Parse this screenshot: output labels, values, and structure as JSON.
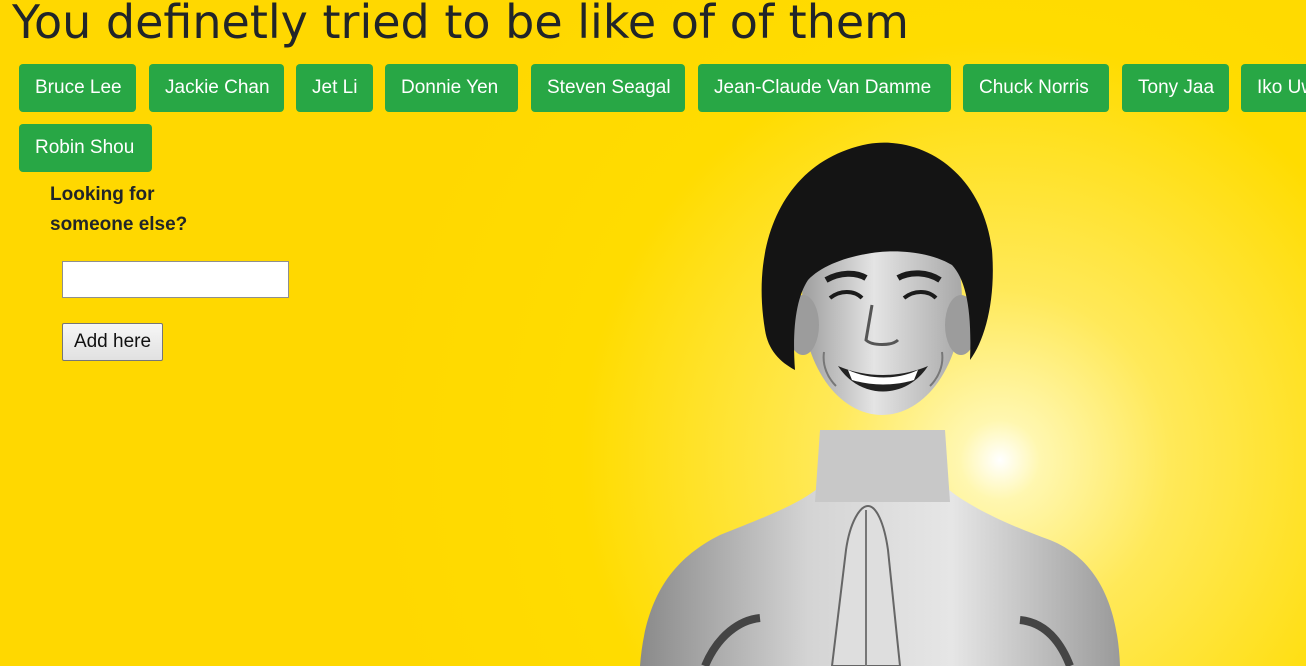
{
  "page": {
    "title": "You definetly tried to be like of of them"
  },
  "actor_buttons": [
    "Bruce Lee",
    "Jackie Chan",
    "Jet Li",
    "Donnie Yen",
    "Steven Seagal",
    "Jean-Claude Van Damme",
    "Chuck Norris",
    "Tony Jaa",
    "Iko Uwais",
    "Robin Shou"
  ],
  "sidebar": {
    "label": "Looking for someone else?",
    "input_value": "",
    "add_button_label": "Add here"
  },
  "colors": {
    "background": "#ffd800",
    "button": "#28a745",
    "button_text": "#ffffff",
    "title_text": "#212529"
  }
}
